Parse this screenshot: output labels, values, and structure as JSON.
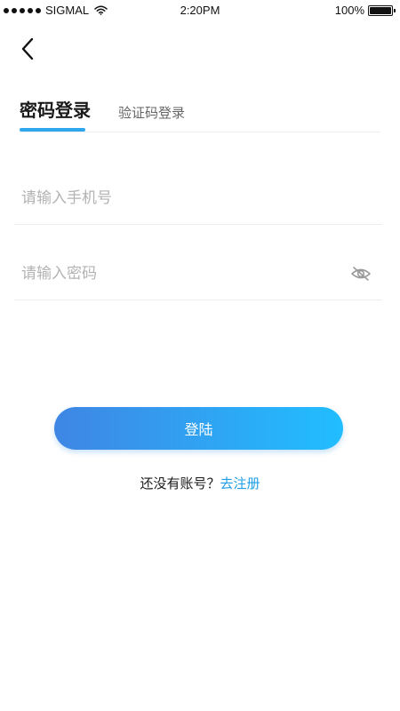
{
  "status_bar": {
    "carrier": "SIGMAL",
    "time": "2:20PM",
    "battery": "100%",
    "battery_level": 1.0
  },
  "header": {
    "back_icon": "chevron-left-icon"
  },
  "tabs": {
    "password_login": "密码登录",
    "code_login": "验证码登录"
  },
  "form": {
    "phone_placeholder": "请输入手机号",
    "phone_value": "",
    "password_placeholder": "请输入密码",
    "password_value": "",
    "visibility_icon": "eye-off-icon"
  },
  "actions": {
    "login_label": "登陆",
    "register_prompt": "还没有账号？",
    "register_link": "去注册"
  },
  "colors": {
    "accent": "#2fa7ee",
    "button_gradient_start": "#3f86e4",
    "button_gradient_end": "#21beff",
    "link": "#1e9ee6",
    "placeholder": "#b3b3b3"
  }
}
